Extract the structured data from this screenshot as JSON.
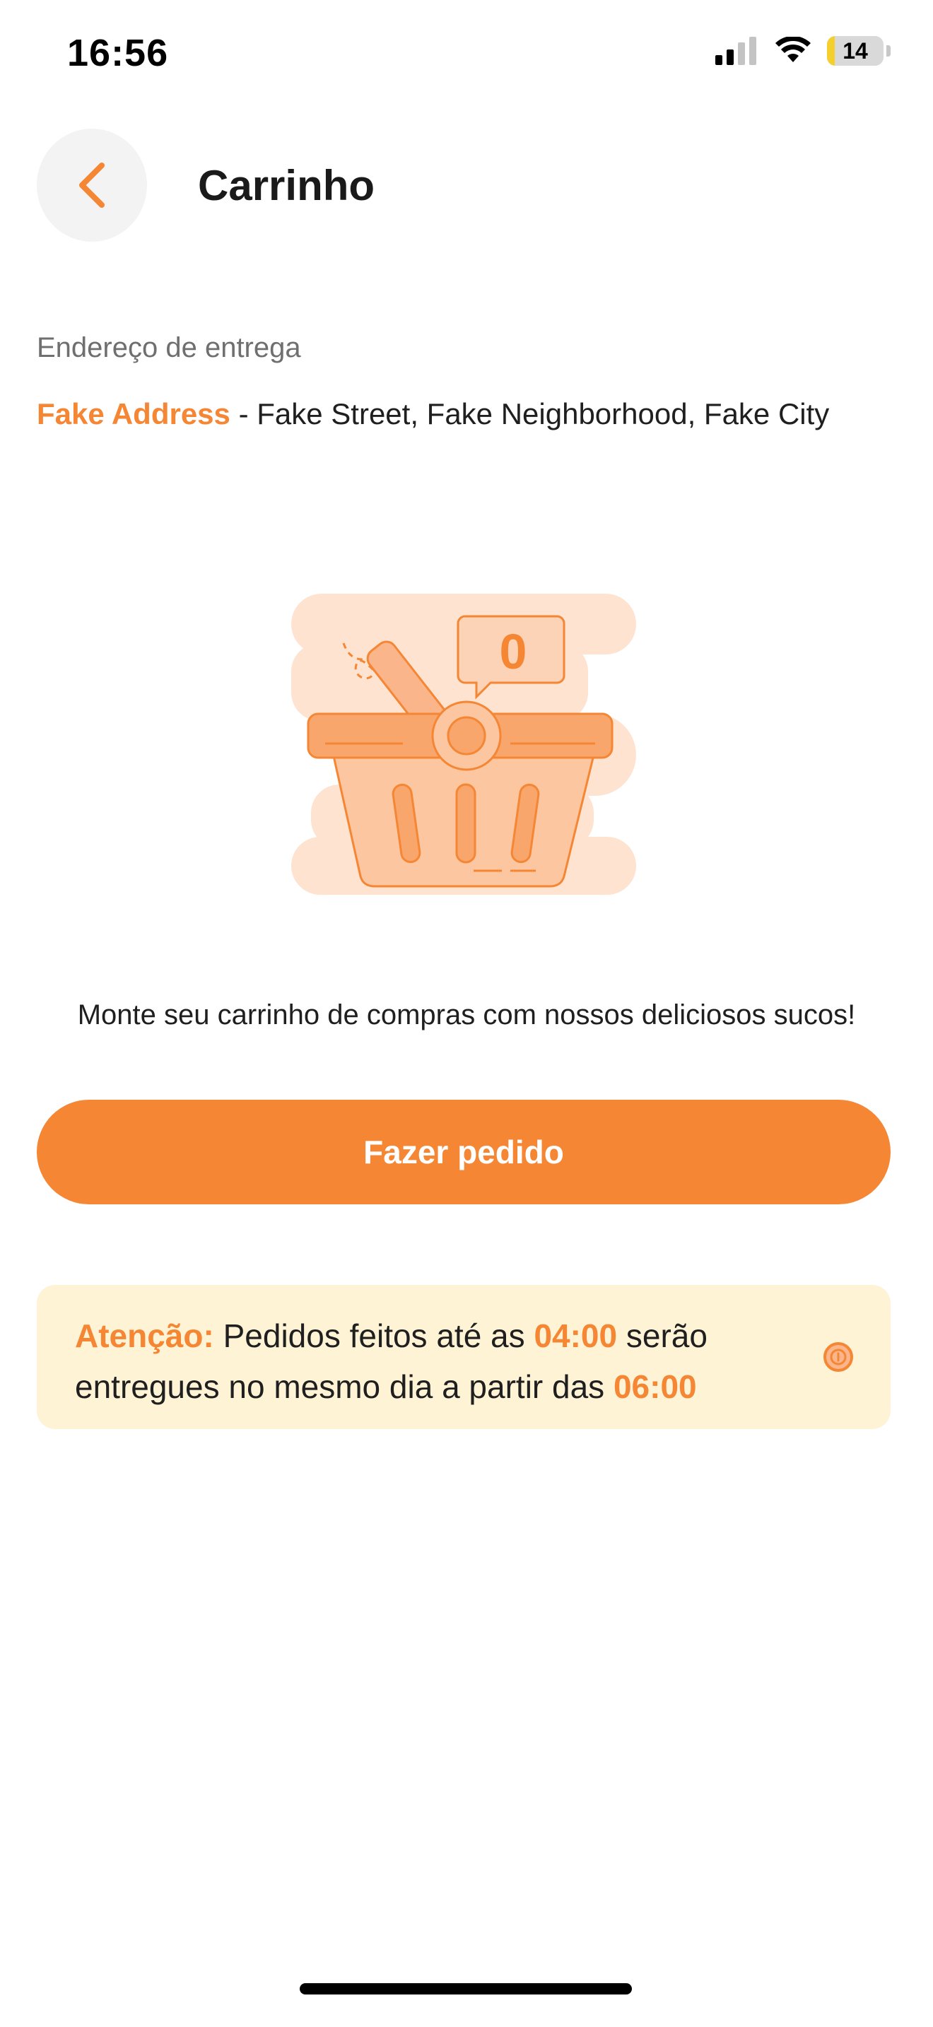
{
  "status_bar": {
    "time": "16:56",
    "battery_level": "14",
    "battery_fraction": 0.14,
    "icons": [
      "signal-icon",
      "wifi-icon",
      "battery-icon"
    ]
  },
  "header": {
    "title": "Carrinho",
    "back_icon": "chevron-left-icon"
  },
  "address": {
    "label": "Endereço de entrega",
    "name": "Fake Address",
    "separator": " - ",
    "detail": "Fake Street, Fake Neighborhood, Fake City"
  },
  "illustration": {
    "icon": "empty-basket-icon",
    "badge_count": "0"
  },
  "empty_message": "Monte seu carrinho de compras com nossos deliciosos sucos!",
  "order_button": {
    "label": "Fazer pedido"
  },
  "notice": {
    "prefix": "Atenção:",
    "text_1": " Pedidos feitos até as ",
    "time_1": "04:00",
    "text_2": " serão entregues no mesmo dia a partir das ",
    "time_2": "06:00",
    "icon": "info-icon"
  },
  "colors": {
    "accent": "#f58634",
    "notice_background": "#fff3d6",
    "illustration_background": "#fde3d0",
    "back_button_background": "#f3f3f3"
  }
}
